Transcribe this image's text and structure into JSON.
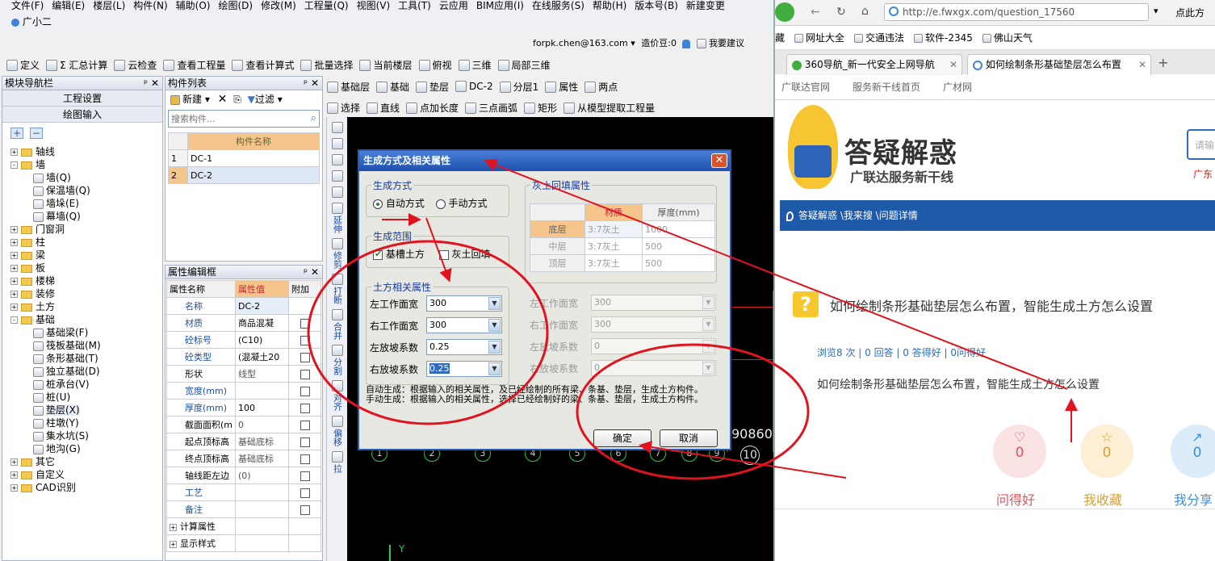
{
  "menu": [
    "文件(F)",
    "编辑(E)",
    "楼层(L)",
    "构件(N)",
    "辅助(O)",
    "绘图(D)",
    "修改(M)",
    "工程量(Q)",
    "视图(V)",
    "工具(T)",
    "云应用",
    "BIM应用(I)",
    "在线服务(S)",
    "帮助(H)",
    "版本号(B)",
    "新建变更"
  ],
  "assistant": "广小二",
  "account": {
    "email": "forpk.chen@163.com",
    "beans": "造价豆:0",
    "suggest": "我要建议"
  },
  "toolbar1": [
    "定义",
    "Σ 汇总计算",
    "云检查",
    "查看工程量",
    "查看计算式",
    "批量选择",
    "当前楼层",
    "俯视",
    "三维",
    "局部三维"
  ],
  "toolbar2": [
    "基础层",
    "基础",
    "垫层",
    "DC-2",
    "分层1",
    "属性",
    "两点"
  ],
  "toolbar3": [
    "选择",
    "直线",
    "点加长度",
    "三点画弧",
    "矩形",
    "从模型提取工程量"
  ],
  "nav": {
    "title": "模块导航栏",
    "project_settings": "工程设置",
    "drawing_input": "绘图输入",
    "tree": [
      {
        "label": "轴线",
        "lvl": 0,
        "exp": "+"
      },
      {
        "label": "墙",
        "lvl": 0,
        "exp": "-"
      },
      {
        "label": "墙(Q)",
        "lvl": 1
      },
      {
        "label": "保温墙(Q)",
        "lvl": 1
      },
      {
        "label": "墙垛(E)",
        "lvl": 1
      },
      {
        "label": "幕墙(Q)",
        "lvl": 1
      },
      {
        "label": "门窗洞",
        "lvl": 0,
        "exp": "+"
      },
      {
        "label": "柱",
        "lvl": 0,
        "exp": "+"
      },
      {
        "label": "梁",
        "lvl": 0,
        "exp": "+"
      },
      {
        "label": "板",
        "lvl": 0,
        "exp": "+"
      },
      {
        "label": "楼梯",
        "lvl": 0,
        "exp": "+"
      },
      {
        "label": "装修",
        "lvl": 0,
        "exp": "+"
      },
      {
        "label": "土方",
        "lvl": 0,
        "exp": "+"
      },
      {
        "label": "基础",
        "lvl": 0,
        "exp": "-"
      },
      {
        "label": "基础梁(F)",
        "lvl": 1
      },
      {
        "label": "筏板基础(M)",
        "lvl": 1
      },
      {
        "label": "条形基础(T)",
        "lvl": 1
      },
      {
        "label": "独立基础(D)",
        "lvl": 1
      },
      {
        "label": "桩承台(V)",
        "lvl": 1
      },
      {
        "label": "桩(U)",
        "lvl": 1
      },
      {
        "label": "垫层(X)",
        "lvl": 1
      },
      {
        "label": "柱墩(Y)",
        "lvl": 1
      },
      {
        "label": "集水坑(S)",
        "lvl": 1
      },
      {
        "label": "地沟(G)",
        "lvl": 1
      },
      {
        "label": "其它",
        "lvl": 0,
        "exp": "+"
      },
      {
        "label": "自定义",
        "lvl": 0,
        "exp": "+"
      },
      {
        "label": "CAD识别",
        "lvl": 0,
        "exp": "+"
      }
    ]
  },
  "components": {
    "title": "构件列表",
    "new_label": "新建",
    "filter_label": "过滤",
    "search_placeholder": "搜索构件...",
    "col_header": "构件名称",
    "rows": [
      {
        "n": "1",
        "name": "DC-1"
      },
      {
        "n": "2",
        "name": "DC-2"
      }
    ]
  },
  "props": {
    "title": "属性编辑框",
    "headers": [
      "属性名称",
      "属性值",
      "附加"
    ],
    "rows": [
      {
        "name": "名称",
        "val": "DC-2",
        "blue": true,
        "chk": false
      },
      {
        "name": "材质",
        "val": "商品混凝",
        "blue": true,
        "chk": true
      },
      {
        "name": "砼标号",
        "val": "(C10)",
        "blue": true,
        "chk": true
      },
      {
        "name": "砼类型",
        "val": "(混凝土20",
        "blue": true,
        "chk": true
      },
      {
        "name": "形状",
        "val": "线型",
        "blue": false,
        "chk": true
      },
      {
        "name": "宽度(mm)",
        "val": "",
        "blue": true,
        "chk": true
      },
      {
        "name": "厚度(mm)",
        "val": "100",
        "blue": true,
        "chk": true
      },
      {
        "name": "截面面积(m",
        "val": "0",
        "blue": false,
        "chk": true
      },
      {
        "name": "起点顶标高",
        "val": "基础底标",
        "blue": false,
        "chk": true
      },
      {
        "name": "终点顶标高",
        "val": "基础底标",
        "blue": false,
        "chk": true
      },
      {
        "name": "轴线距左边",
        "val": "(0)",
        "blue": false,
        "chk": true
      },
      {
        "name": "工艺",
        "val": "",
        "blue": true,
        "chk": true
      },
      {
        "name": "备注",
        "val": "",
        "blue": true,
        "chk": true
      },
      {
        "name": "计算属性",
        "val": "",
        "blue": false,
        "chk": false,
        "exp": "+"
      },
      {
        "name": "显示样式",
        "val": "",
        "blue": false,
        "chk": false,
        "exp": "+"
      }
    ]
  },
  "vtools": [
    "延伸",
    "修剪",
    "打断",
    "合并",
    "分割",
    "对齐",
    "偏移",
    "拉"
  ],
  "dialog": {
    "title": "生成方式及相关属性",
    "method_group": "生成方式",
    "auto": "自动方式",
    "manual": "手动方式",
    "range_group": "生成范围",
    "trench": "基槽土方",
    "backfill": "灰土回填",
    "soil_group": "土方相关属性",
    "backfill_group": "灰土回填属性",
    "bf_headers": [
      "材质",
      "厚度(mm)"
    ],
    "bf_rows": [
      {
        "layer": "底层",
        "mat": "3:7灰土",
        "thick": "1000"
      },
      {
        "layer": "中层",
        "mat": "3:7灰土",
        "thick": "500"
      },
      {
        "layer": "顶层",
        "mat": "3:7灰土",
        "thick": "500"
      }
    ],
    "fields": [
      {
        "label": "左工作面宽",
        "val": "300"
      },
      {
        "label": "右工作面宽",
        "val": "300"
      },
      {
        "label": "左放坡系数",
        "val": "0.25"
      },
      {
        "label": "右放坡系数",
        "val": "0.25"
      }
    ],
    "rfields": [
      {
        "label": "左工作面宽",
        "val": "300"
      },
      {
        "label": "右工作面宽",
        "val": "300"
      },
      {
        "label": "左放坡系数",
        "val": "0"
      },
      {
        "label": "右放坡系数",
        "val": "0"
      }
    ],
    "note_auto": "自动生成：根据输入的相关属性，及已经绘制的所有梁、条基、垫层，生成土方构件。",
    "note_manual": "手动生成：根据输入的相关属性，选择已经绘制好的梁、条基、垫层，生成土方构件。",
    "ok": "确定",
    "cancel": "取消"
  },
  "axes": [
    "1",
    "2",
    "3",
    "4",
    "5",
    "6",
    "7",
    "8",
    "9",
    "10"
  ],
  "axis_numbers": "90860",
  "axis_y": "Y",
  "browser": {
    "url": "http://e.fwxgx.com/question_17560",
    "click": "点此方",
    "bookmarks": [
      "藏",
      "网址大全",
      "交通违法",
      "软件-2345",
      "佛山天气"
    ],
    "tabs": [
      "360导航_新一代安全上网导航",
      "如何绘制条形基础垫层怎么布置"
    ],
    "site_links": [
      "广联达官网",
      "服务新干线首页",
      "广材网"
    ],
    "logo_title": "答疑解惑",
    "logo_sub": "广联达服务新干线",
    "search_placeholder": "请输",
    "region": "广东",
    "breadcrumb": "答疑解惑 \\我来搜 \\问题详情",
    "question_title": "如何绘制条形基础垫层怎么布置，智能生成土方怎么设置",
    "stats": "浏览8 次 | 0 回答 | 0 答得好 | 0问得好",
    "question_body": "如何绘制条形基础垫层怎么布置，智能生成土方怎么设置",
    "actions": [
      {
        "label": "问得好",
        "count": "0",
        "color": "#e0565b",
        "bg": "#fbe3e4"
      },
      {
        "label": "我收藏",
        "count": "0",
        "color": "#d9a02a",
        "bg": "#fcefd6"
      },
      {
        "label": "我分享",
        "count": "0",
        "color": "#3b8fd6",
        "bg": "#dcecf9"
      }
    ]
  }
}
